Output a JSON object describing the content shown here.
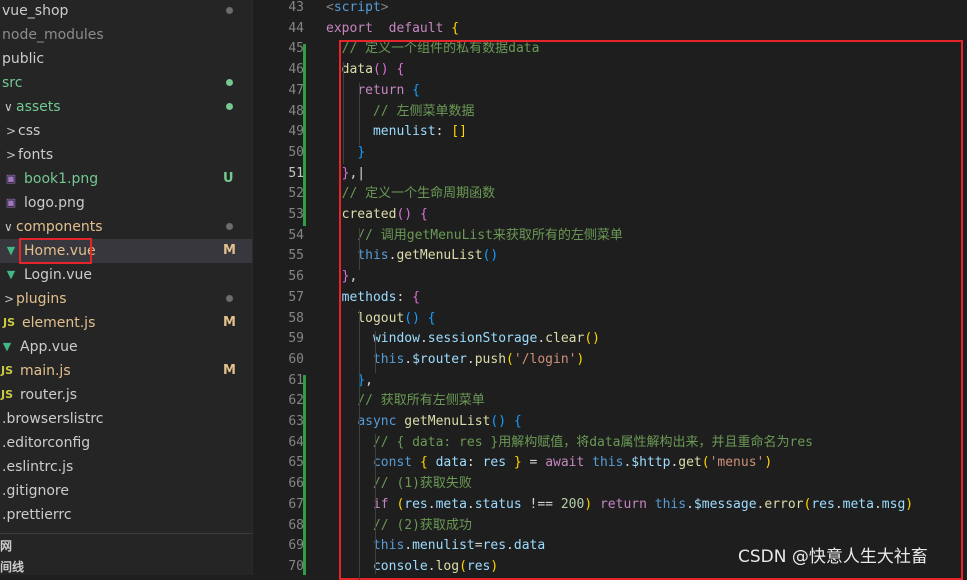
{
  "explorer": {
    "items": [
      {
        "label": "vue_shop",
        "indent": 0,
        "chevron": "",
        "icon": "",
        "color": "#cccccc",
        "badge": "dot",
        "badge_color": "#6c6c6c"
      },
      {
        "label": "node_modules",
        "indent": 0,
        "chevron": "",
        "icon": "",
        "color": "#8c8c8c",
        "badge": "",
        "badge_color": ""
      },
      {
        "label": "public",
        "indent": 0,
        "chevron": "",
        "icon": "",
        "color": "#cccccc",
        "badge": "",
        "badge_color": ""
      },
      {
        "label": "src",
        "indent": 0,
        "chevron": "",
        "icon": "",
        "color": "#73c991",
        "badge": "dot",
        "badge_color": "#73c991"
      },
      {
        "label": "assets",
        "indent": 1,
        "chevron": "∨",
        "icon": "",
        "color": "#73c991",
        "badge": "dot",
        "badge_color": "#73c991"
      },
      {
        "label": "css",
        "indent": 2,
        "chevron": ">",
        "icon": "",
        "color": "#cccccc",
        "badge": "",
        "badge_color": ""
      },
      {
        "label": "fonts",
        "indent": 2,
        "chevron": ">",
        "icon": "",
        "color": "#cccccc",
        "badge": "",
        "badge_color": ""
      },
      {
        "label": "book1.png",
        "indent": 2,
        "chevron": "",
        "icon": "png",
        "color": "#73c991",
        "badge": "U",
        "badge_color": "#73c991"
      },
      {
        "label": "logo.png",
        "indent": 2,
        "chevron": "",
        "icon": "png",
        "color": "#cccccc",
        "badge": "",
        "badge_color": ""
      },
      {
        "label": "components",
        "indent": 1,
        "chevron": "∨",
        "icon": "",
        "color": "#e2c08d",
        "badge": "dot",
        "badge_color": "#6c6c6c"
      },
      {
        "label": "Home.vue",
        "indent": 2,
        "chevron": "",
        "icon": "vue",
        "color": "#e2c08d",
        "badge": "M",
        "badge_color": "#e2c08d"
      },
      {
        "label": "Login.vue",
        "indent": 2,
        "chevron": "",
        "icon": "vue",
        "color": "#cccccc",
        "badge": "",
        "badge_color": ""
      },
      {
        "label": "plugins",
        "indent": 1,
        "chevron": ">",
        "icon": "",
        "color": "#e2c08d",
        "badge": "dot",
        "badge_color": "#6c6c6c"
      },
      {
        "label": "element.js",
        "indent": 1,
        "chevron": "",
        "icon": "js",
        "color": "#e2c08d",
        "badge": "M",
        "badge_color": "#e2c08d"
      },
      {
        "label": "App.vue",
        "indent": 0,
        "chevron": "",
        "icon": "vue",
        "color": "#cccccc",
        "badge": "",
        "badge_color": ""
      },
      {
        "label": "main.js",
        "indent": 0,
        "chevron": "",
        "icon": "js",
        "color": "#e2c08d",
        "badge": "M",
        "badge_color": "#e2c08d"
      },
      {
        "label": "router.js",
        "indent": 0,
        "chevron": "",
        "icon": "js",
        "color": "#cccccc",
        "badge": "",
        "badge_color": ""
      },
      {
        "label": ".browserslistrc",
        "indent": 0,
        "chevron": "",
        "icon": "",
        "color": "#cccccc",
        "badge": "",
        "badge_color": ""
      },
      {
        "label": ".editorconfig",
        "indent": 0,
        "chevron": "",
        "icon": "",
        "color": "#cccccc",
        "badge": "",
        "badge_color": ""
      },
      {
        "label": ".eslintrc.js",
        "indent": 0,
        "chevron": "",
        "icon": "",
        "color": "#cccccc",
        "badge": "",
        "badge_color": ""
      },
      {
        "label": ".gitignore",
        "indent": 0,
        "chevron": "",
        "icon": "",
        "color": "#cccccc",
        "badge": "",
        "badge_color": ""
      },
      {
        "label": ".prettierrc",
        "indent": 0,
        "chevron": "",
        "icon": "",
        "color": "#cccccc",
        "badge": "",
        "badge_color": ""
      }
    ],
    "section1": "网",
    "section2": "间线"
  },
  "editor": {
    "current_line": 51,
    "lines": [
      {
        "n": "43",
        "t": [
          [
            "tag",
            "<"
          ],
          [
            "kw",
            "script"
          ],
          [
            "tag",
            ">"
          ]
        ]
      },
      {
        "n": "44",
        "t": [
          [
            "ctl",
            "export"
          ],
          [
            "",
            "  "
          ],
          [
            "ctl",
            "default"
          ],
          [
            "",
            " "
          ],
          [
            "br1",
            "{"
          ]
        ]
      },
      {
        "n": "45",
        "t": [
          [
            "",
            "  "
          ],
          [
            "cm",
            "// 定义一个组件的私有数据data"
          ]
        ]
      },
      {
        "n": "46",
        "t": [
          [
            "",
            "  "
          ],
          [
            "fn",
            "data"
          ],
          [
            "br2",
            "()"
          ],
          [
            "",
            " "
          ],
          [
            "br2",
            "{"
          ]
        ]
      },
      {
        "n": "47",
        "t": [
          [
            "",
            "    "
          ],
          [
            "ctl",
            "return"
          ],
          [
            "",
            " "
          ],
          [
            "br3",
            "{"
          ]
        ]
      },
      {
        "n": "48",
        "t": [
          [
            "",
            "      "
          ],
          [
            "cm",
            "// 左侧菜单数据"
          ]
        ]
      },
      {
        "n": "49",
        "t": [
          [
            "",
            "      "
          ],
          [
            "var",
            "menulist"
          ],
          [
            "",
            ": "
          ],
          [
            "br1",
            "[]"
          ]
        ]
      },
      {
        "n": "50",
        "t": [
          [
            "",
            "    "
          ],
          [
            "br3",
            "}"
          ]
        ]
      },
      {
        "n": "51",
        "t": [
          [
            "",
            "  "
          ],
          [
            "br2",
            "}"
          ],
          [
            "",
            ",|"
          ]
        ]
      },
      {
        "n": "52",
        "t": [
          [
            "",
            "  "
          ],
          [
            "cm",
            "// 定义一个生命周期函数"
          ]
        ]
      },
      {
        "n": "53",
        "t": [
          [
            "",
            "  "
          ],
          [
            "fn",
            "created"
          ],
          [
            "br2",
            "()"
          ],
          [
            "",
            " "
          ],
          [
            "br2",
            "{"
          ]
        ]
      },
      {
        "n": "54",
        "t": [
          [
            "",
            "    "
          ],
          [
            "cm",
            "// 调用getMenuList来获取所有的左侧菜单"
          ]
        ]
      },
      {
        "n": "55",
        "t": [
          [
            "",
            "    "
          ],
          [
            "kw",
            "this"
          ],
          [
            "",
            "."
          ],
          [
            "fn",
            "getMenuList"
          ],
          [
            "br3",
            "()"
          ]
        ]
      },
      {
        "n": "56",
        "t": [
          [
            "",
            "  "
          ],
          [
            "br2",
            "}"
          ],
          [
            "",
            ","
          ]
        ]
      },
      {
        "n": "57",
        "t": [
          [
            "",
            "  "
          ],
          [
            "var",
            "methods"
          ],
          [
            "",
            ": "
          ],
          [
            "br2",
            "{"
          ]
        ]
      },
      {
        "n": "58",
        "t": [
          [
            "",
            "    "
          ],
          [
            "fn",
            "logout"
          ],
          [
            "br3",
            "()"
          ],
          [
            "",
            " "
          ],
          [
            "br3",
            "{"
          ]
        ]
      },
      {
        "n": "59",
        "t": [
          [
            "",
            "      "
          ],
          [
            "var",
            "window"
          ],
          [
            "",
            "."
          ],
          [
            "var",
            "sessionStorage"
          ],
          [
            "",
            "."
          ],
          [
            "fn",
            "clear"
          ],
          [
            "br1",
            "()"
          ]
        ]
      },
      {
        "n": "60",
        "t": [
          [
            "",
            "      "
          ],
          [
            "kw",
            "this"
          ],
          [
            "",
            "."
          ],
          [
            "var",
            "$router"
          ],
          [
            "",
            "."
          ],
          [
            "fn",
            "push"
          ],
          [
            "br1",
            "("
          ],
          [
            "str",
            "'/login'"
          ],
          [
            "br1",
            ")"
          ]
        ]
      },
      {
        "n": "61",
        "t": [
          [
            "",
            "    "
          ],
          [
            "br3",
            "}"
          ],
          [
            "",
            ","
          ]
        ]
      },
      {
        "n": "62",
        "t": [
          [
            "",
            "    "
          ],
          [
            "cm",
            "// 获取所有左侧菜单"
          ]
        ]
      },
      {
        "n": "63",
        "t": [
          [
            "",
            "    "
          ],
          [
            "kw",
            "async"
          ],
          [
            "",
            " "
          ],
          [
            "fn",
            "getMenuList"
          ],
          [
            "br3",
            "()"
          ],
          [
            "",
            " "
          ],
          [
            "br3",
            "{"
          ]
        ]
      },
      {
        "n": "64",
        "t": [
          [
            "",
            "      "
          ],
          [
            "cm",
            "// { data: res }用解构赋值，将data属性解构出来，并且重命名为res"
          ]
        ]
      },
      {
        "n": "65",
        "t": [
          [
            "",
            "      "
          ],
          [
            "kw",
            "const"
          ],
          [
            "",
            " "
          ],
          [
            "br1",
            "{"
          ],
          [
            "",
            " "
          ],
          [
            "var",
            "data"
          ],
          [
            "",
            ": "
          ],
          [
            "var",
            "res"
          ],
          [
            "",
            " "
          ],
          [
            "br1",
            "}"
          ],
          [
            "",
            " = "
          ],
          [
            "ctl",
            "await"
          ],
          [
            "",
            " "
          ],
          [
            "kw",
            "this"
          ],
          [
            "",
            "."
          ],
          [
            "var",
            "$http"
          ],
          [
            "",
            "."
          ],
          [
            "fn",
            "get"
          ],
          [
            "br1",
            "("
          ],
          [
            "str",
            "'menus'"
          ],
          [
            "br1",
            ")"
          ]
        ]
      },
      {
        "n": "66",
        "t": [
          [
            "",
            "      "
          ],
          [
            "cm",
            "// (1)获取失败"
          ]
        ]
      },
      {
        "n": "67",
        "t": [
          [
            "",
            "      "
          ],
          [
            "ctl",
            "if"
          ],
          [
            "",
            " "
          ],
          [
            "br1",
            "("
          ],
          [
            "var",
            "res"
          ],
          [
            "",
            "."
          ],
          [
            "var",
            "meta"
          ],
          [
            "",
            "."
          ],
          [
            "var",
            "status"
          ],
          [
            "",
            " !== "
          ],
          [
            "num",
            "200"
          ],
          [
            "br1",
            ")"
          ],
          [
            "",
            " "
          ],
          [
            "ctl",
            "return"
          ],
          [
            "",
            " "
          ],
          [
            "kw",
            "this"
          ],
          [
            "",
            "."
          ],
          [
            "var",
            "$message"
          ],
          [
            "",
            "."
          ],
          [
            "fn",
            "error"
          ],
          [
            "br1",
            "("
          ],
          [
            "var",
            "res"
          ],
          [
            "",
            "."
          ],
          [
            "var",
            "meta"
          ],
          [
            "",
            "."
          ],
          [
            "var",
            "msg"
          ],
          [
            "br1",
            ")"
          ]
        ]
      },
      {
        "n": "68",
        "t": [
          [
            "",
            "      "
          ],
          [
            "cm",
            "// (2)获取成功"
          ]
        ]
      },
      {
        "n": "69",
        "t": [
          [
            "",
            "      "
          ],
          [
            "kw",
            "this"
          ],
          [
            "",
            "."
          ],
          [
            "var",
            "menulist"
          ],
          [
            "",
            "="
          ],
          [
            "var",
            "res"
          ],
          [
            "",
            "."
          ],
          [
            "var",
            "data"
          ]
        ]
      },
      {
        "n": "70",
        "t": [
          [
            "",
            "      "
          ],
          [
            "var",
            "console"
          ],
          [
            "",
            "."
          ],
          [
            "fn",
            "log"
          ],
          [
            "br1",
            "("
          ],
          [
            "var",
            "res"
          ],
          [
            "br1",
            ")"
          ]
        ]
      }
    ]
  },
  "watermark": "CSDN @快意人生大社畜"
}
